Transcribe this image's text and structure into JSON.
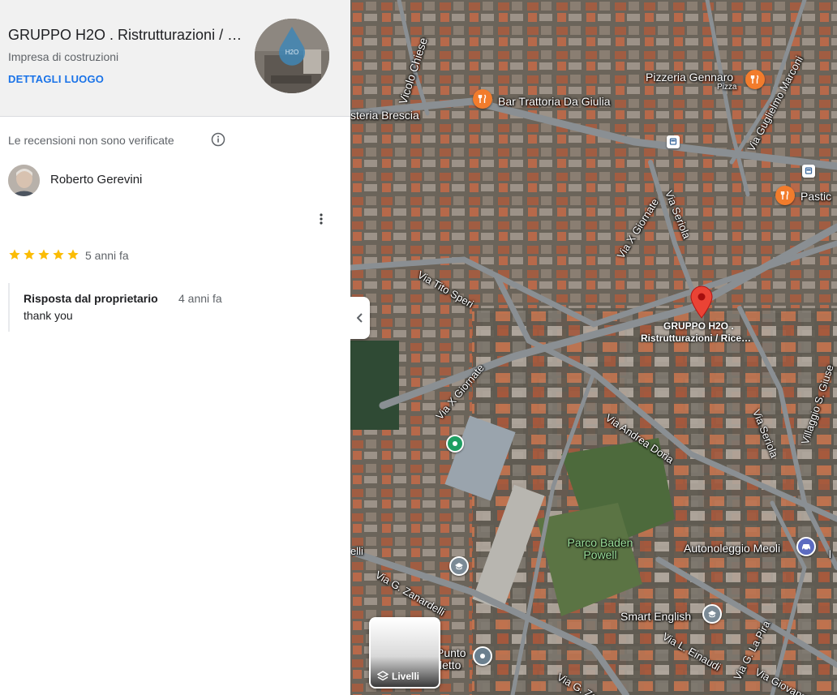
{
  "place": {
    "title": "GRUPPO H2O . Ristrutturazioni / …",
    "category": "Impresa di costruzioni",
    "details_link": "DETTAGLI LUOGO"
  },
  "reviews": {
    "disclaimer": "Le recensioni non sono verificate",
    "reviewer_name": "Roberto Gerevini",
    "rating": 5,
    "date": "5 anni fa",
    "owner_reply": {
      "title": "Risposta dal proprietario",
      "date": "4 anni fa",
      "text": "thank you"
    }
  },
  "map": {
    "labels": {
      "vicolo_chiese": "Vicolo Chiese",
      "bar_trattoria": "Bar Trattoria Da Giulia",
      "osteria": "steria Brescia",
      "pizzeria": "Pizzeria Gennaro",
      "pizzeria_sub": "Pizza",
      "via_marconi": "Via Guglielmo Marconi",
      "pastic": "Pastic",
      "via_x_giornate_top": "Via X Giornate",
      "via_seriola_top": "Via Seriola",
      "via_tito_speri": "Via Tito Speri",
      "via_x_giornate_mid": "Via X Giornate",
      "via_andrea_doria": "Via Andrea Doria",
      "via_seriola_bottom": "Via Seriola",
      "villaggio": "Villaggio S. Giuse",
      "parco": "Parco Baden Powell",
      "autonoleggio": "Autonoleggio Meoli",
      "via_zanardelli": "Via G. Zanardelli",
      "smart_english": "Smart English",
      "via_einaudi": "Via L. Einaudi",
      "via_la_pira": "Via G. La Pira",
      "via_giovanni": "Via Giovanni",
      "punto": "Punto",
      "letto": "letto",
      "via_g_bottom": "Via G. Za",
      "edge_elli": "elli",
      "edge_l": "l"
    },
    "pin_label_line1": "GRUPPO H2O .",
    "pin_label_line2": "Ristrutturazioni / Rice…",
    "layers_label": "Livelli",
    "accent_color": "#ea4335"
  }
}
